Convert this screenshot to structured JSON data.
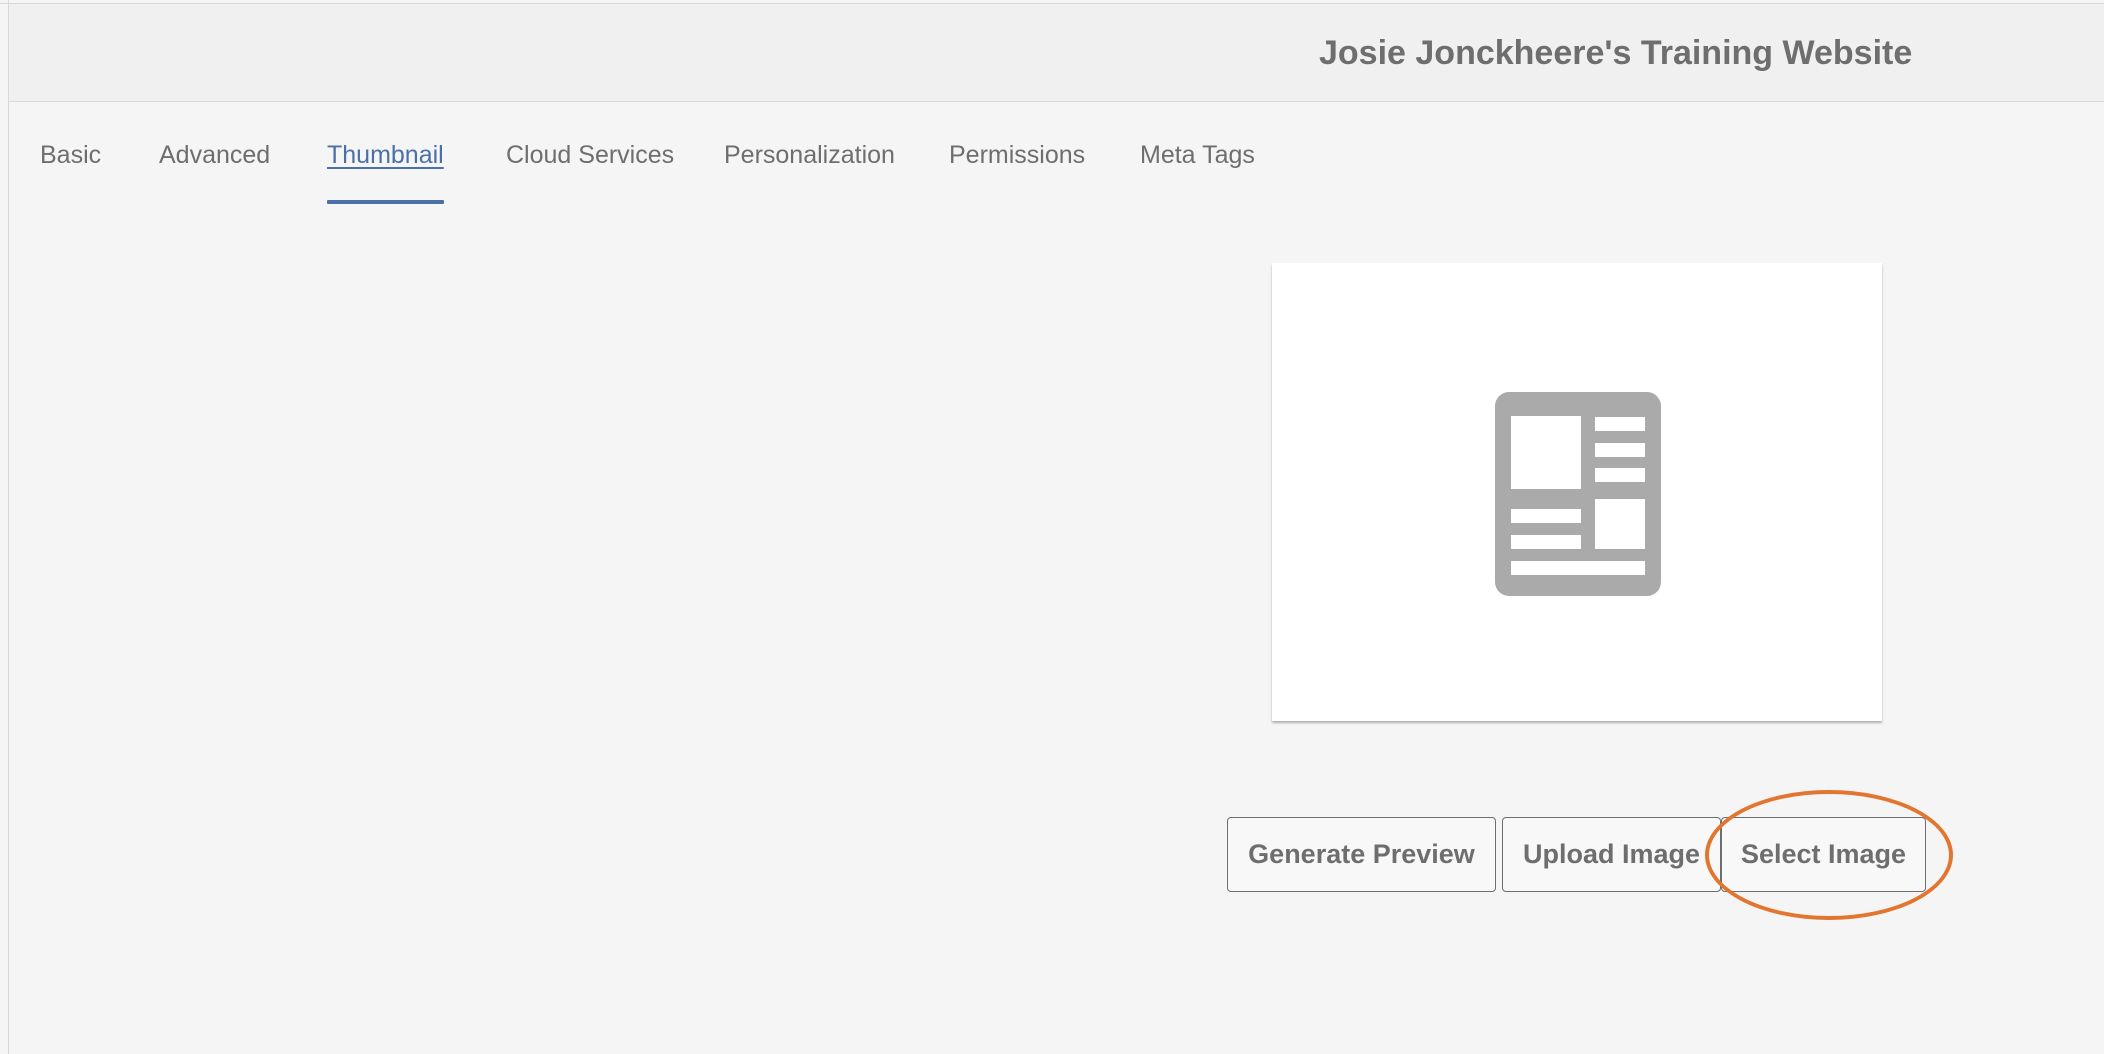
{
  "header": {
    "title": "Josie Jonckheere's Training Website"
  },
  "tabs": [
    {
      "label": "Basic",
      "active": false
    },
    {
      "label": "Advanced",
      "active": false
    },
    {
      "label": "Thumbnail",
      "active": true
    },
    {
      "label": "Cloud Services",
      "active": false
    },
    {
      "label": "Personalization",
      "active": false
    },
    {
      "label": "Permissions",
      "active": false
    },
    {
      "label": "Meta Tags",
      "active": false
    }
  ],
  "thumbnail": {
    "icon": "page-placeholder-icon"
  },
  "actions": {
    "generate_preview_label": "Generate Preview",
    "upload_image_label": "Upload Image",
    "select_image_label": "Select Image"
  },
  "colors": {
    "accent": "#4b6fa8",
    "highlight": "#e2752f",
    "text": "#6e6e6e",
    "icon": "#aaaaaa"
  }
}
